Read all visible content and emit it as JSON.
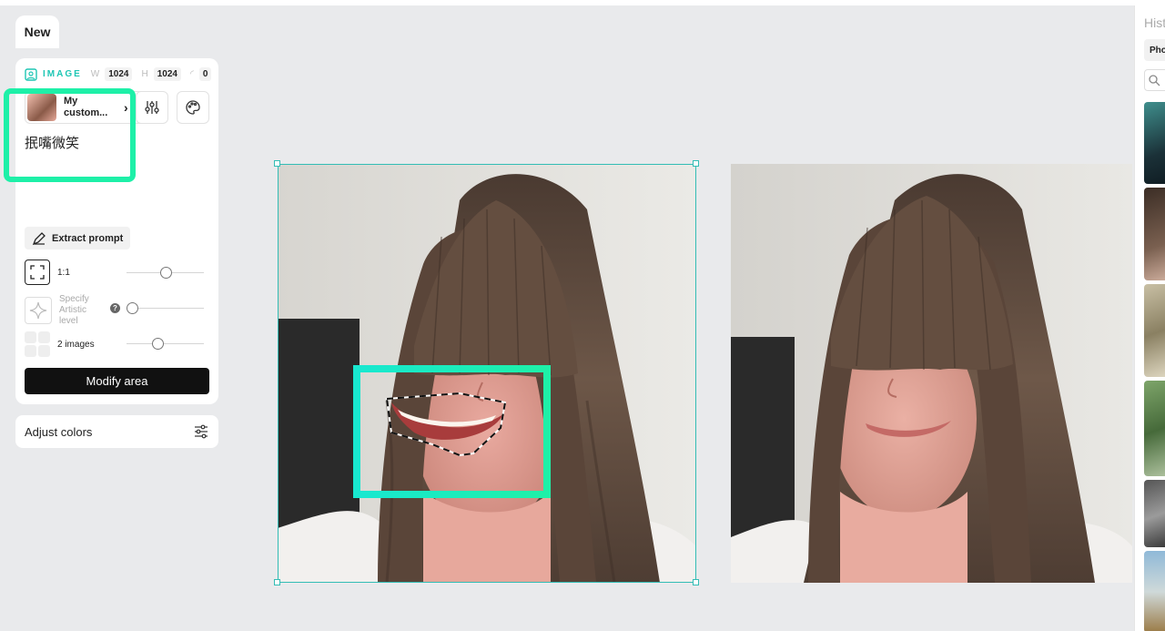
{
  "app": {
    "new_tab": "New"
  },
  "image_panel": {
    "label": "IMAGE",
    "width_key": "W",
    "width": "1024",
    "height_key": "H",
    "height": "1024",
    "seed": "0",
    "custom_model": "My custom...",
    "prompt": "抿嘴微笑",
    "extract_prompt": "Extract prompt",
    "aspect_ratio": "1:1",
    "artistic_label": "Specify Artistic level",
    "images_count": "2 images",
    "modify_button": "Modify area",
    "slider_aspect": 0.5,
    "slider_artistic": 0.0,
    "slider_count": 0.38
  },
  "adjust_colors": "Adjust colors",
  "history": {
    "title": "History",
    "tab": "Photo"
  },
  "colors": {
    "accent": "#1ec6b4",
    "highlight": "#1ef0a8",
    "selection": "#33bdb5"
  },
  "icons": [
    "image-icon",
    "chevron-right-icon",
    "sliders-icon",
    "palette-icon",
    "pen-icon",
    "aspect-ratio-icon",
    "sparkle-icon",
    "help-icon",
    "grid-icon",
    "adjust-sliders-icon",
    "search-icon"
  ]
}
